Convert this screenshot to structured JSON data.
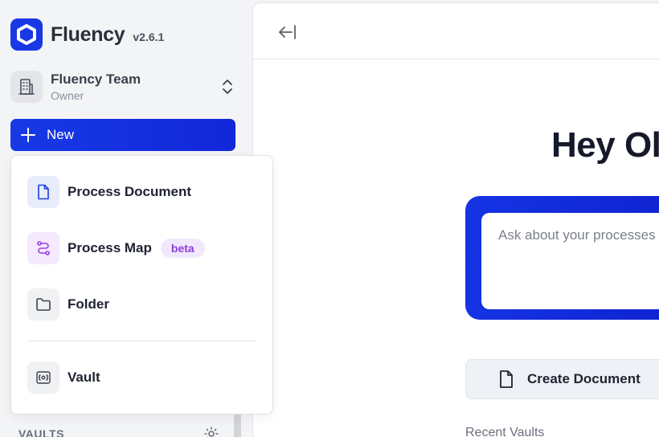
{
  "brand": {
    "name": "Fluency",
    "version": "v2.6.1"
  },
  "team": {
    "name": "Fluency Team",
    "role": "Owner"
  },
  "new_button": {
    "label": "New"
  },
  "menu": {
    "items": [
      {
        "label": "Process Document",
        "icon": "document-icon"
      },
      {
        "label": "Process Map",
        "icon": "process-map-icon",
        "badge": "beta"
      },
      {
        "label": "Folder",
        "icon": "folder-icon"
      },
      {
        "label": "Vault",
        "icon": "vault-icon"
      }
    ]
  },
  "sidebar": {
    "vaults_label": "VAULTS"
  },
  "main": {
    "greeting": "Hey Ol",
    "ask_placeholder": "Ask about your processes",
    "create_document_label": "Create Document",
    "recent_vaults_label": "Recent Vaults"
  },
  "colors": {
    "accent": "#1739e6",
    "beta_bg": "#f2e8fd",
    "beta_text": "#8e3ae0"
  }
}
